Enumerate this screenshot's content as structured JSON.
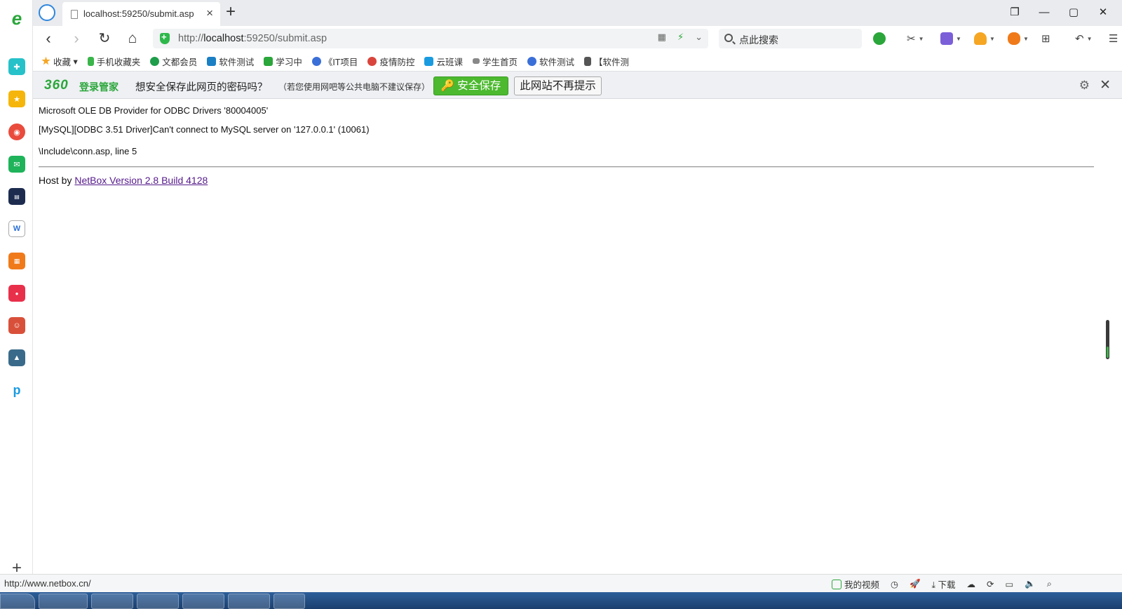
{
  "tab": {
    "title": "localhost:59250/submit.asp",
    "close": "×",
    "new": "+"
  },
  "window": {
    "restore_label": "❐",
    "minimize_label": "—",
    "maximize_label": "▢",
    "close_label": "✕"
  },
  "toolbar": {
    "back": "‹",
    "forward": "›",
    "reload": "↻",
    "home": "⌂",
    "url_prefix": "http://",
    "url_host": "localhost",
    "url_rest": ":59250/submit.asp",
    "search_placeholder": "点此搜索"
  },
  "bookmarks": [
    {
      "label": "收藏",
      "color": "#f5a623"
    },
    {
      "label": "手机收藏夹",
      "color": "#3ab54a"
    },
    {
      "label": "文都会员",
      "color": "#1e9e4a"
    },
    {
      "label": "软件测试",
      "color": "#1b7fc4"
    },
    {
      "label": "学习中",
      "color": "#2aa63a"
    },
    {
      "label": "《IT项目",
      "color": "#3b6fd8"
    },
    {
      "label": "疫情防控",
      "color": "#d9453c"
    },
    {
      "label": "云班课",
      "color": "#1a9be0"
    },
    {
      "label": "学生首页",
      "color": "#888888"
    },
    {
      "label": "软件测试",
      "color": "#3b6fd8"
    },
    {
      "label": "【软件测",
      "color": "#555555"
    }
  ],
  "password_bar": {
    "logo": "360",
    "logo_sub": "登录管家",
    "question": "想安全保存此网页的密码吗？",
    "hint": "（若您使用网吧等公共电脑不建议保存）",
    "save_button": "🔑 安全保存",
    "never_button": "此网站不再提示",
    "gear": "⚙",
    "close": "✕"
  },
  "page": {
    "error_provider": "Microsoft OLE DB Provider for ODBC Drivers '80004005'",
    "error_detail": "[MySQL][ODBC 3.51 Driver]Can't connect to MySQL server on '127.0.0.1' (10061)",
    "error_file": "\\Include\\conn.asp, line 5",
    "host_prefix": "Host by ",
    "host_link": "NetBox Version 2.8 Build 4128"
  },
  "statusbar": {
    "url": "http://www.netbox.cn/",
    "my_video": "我的视频",
    "download": "下载"
  },
  "colors": {
    "accent_green": "#4cb92f",
    "link": "#551a8b"
  }
}
